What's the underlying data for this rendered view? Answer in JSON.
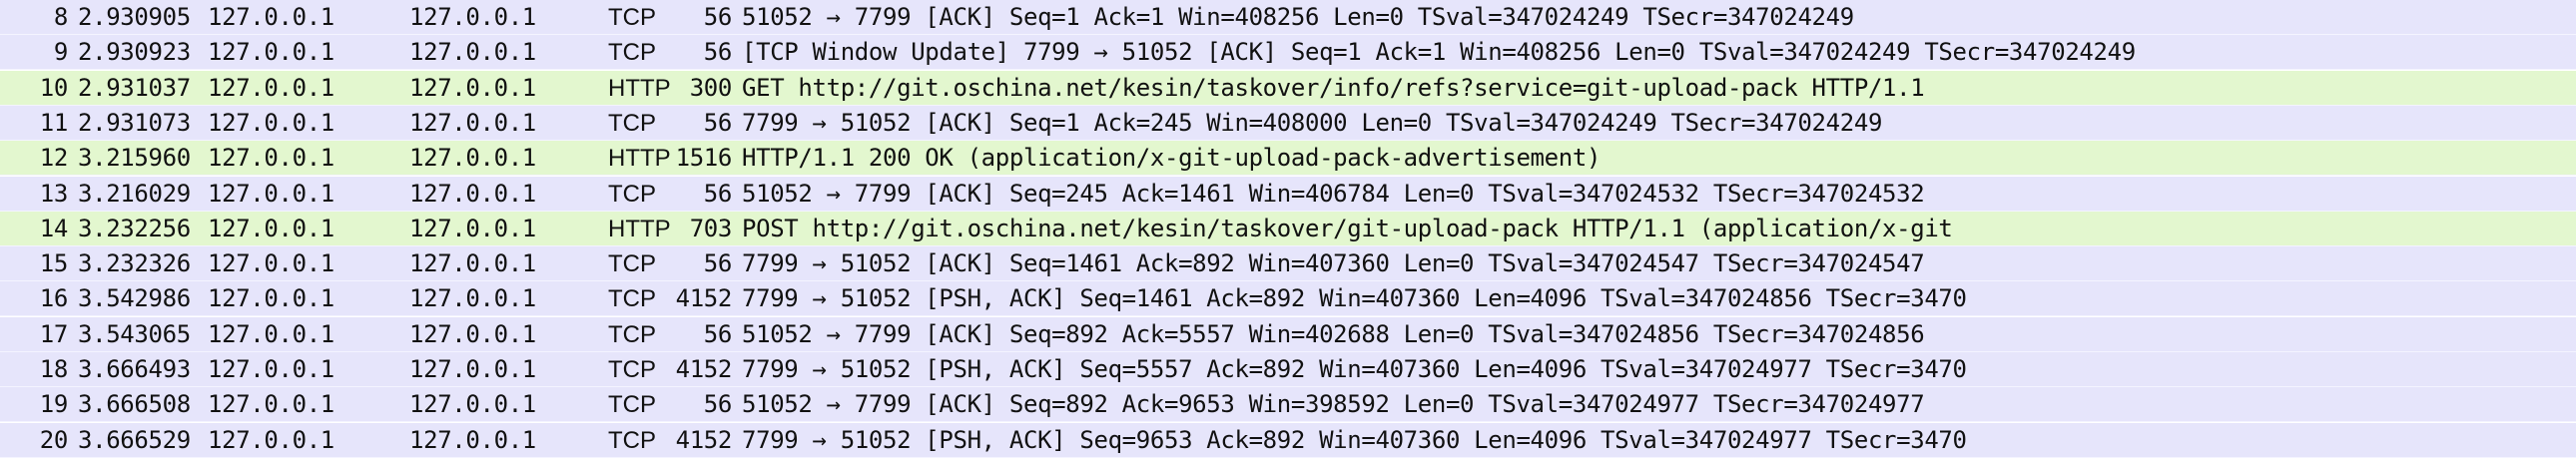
{
  "packet_list": {
    "rows": [
      {
        "no": "8",
        "time": "2.930905",
        "source": "127.0.0.1",
        "destination": "127.0.0.1",
        "protocol": "TCP",
        "length": "56",
        "info": "51052 → 7799 [ACK] Seq=1 Ack=1 Win=408256 Len=0 TSval=347024249 TSecr=347024249"
      },
      {
        "no": "9",
        "time": "2.930923",
        "source": "127.0.0.1",
        "destination": "127.0.0.1",
        "protocol": "TCP",
        "length": "56",
        "info": "[TCP Window Update] 7799 → 51052 [ACK] Seq=1 Ack=1 Win=408256 Len=0 TSval=347024249 TSecr=347024249"
      },
      {
        "no": "10",
        "time": "2.931037",
        "source": "127.0.0.1",
        "destination": "127.0.0.1",
        "protocol": "HTTP",
        "length": "300",
        "info": "GET http://git.oschina.net/kesin/taskover/info/refs?service=git-upload-pack HTTP/1.1"
      },
      {
        "no": "11",
        "time": "2.931073",
        "source": "127.0.0.1",
        "destination": "127.0.0.1",
        "protocol": "TCP",
        "length": "56",
        "info": "7799 → 51052 [ACK] Seq=1 Ack=245 Win=408000 Len=0 TSval=347024249 TSecr=347024249"
      },
      {
        "no": "12",
        "time": "3.215960",
        "source": "127.0.0.1",
        "destination": "127.0.0.1",
        "protocol": "HTTP",
        "length": "1516",
        "info": "HTTP/1.1 200 OK  (application/x-git-upload-pack-advertisement)"
      },
      {
        "no": "13",
        "time": "3.216029",
        "source": "127.0.0.1",
        "destination": "127.0.0.1",
        "protocol": "TCP",
        "length": "56",
        "info": "51052 → 7799 [ACK] Seq=245 Ack=1461 Win=406784 Len=0 TSval=347024532 TSecr=347024532"
      },
      {
        "no": "14",
        "time": "3.232256",
        "source": "127.0.0.1",
        "destination": "127.0.0.1",
        "protocol": "HTTP",
        "length": "703",
        "info": "POST http://git.oschina.net/kesin/taskover/git-upload-pack HTTP/1.1  (application/x-git"
      },
      {
        "no": "15",
        "time": "3.232326",
        "source": "127.0.0.1",
        "destination": "127.0.0.1",
        "protocol": "TCP",
        "length": "56",
        "info": "7799 → 51052 [ACK] Seq=1461 Ack=892 Win=407360 Len=0 TSval=347024547 TSecr=347024547"
      },
      {
        "no": "16",
        "time": "3.542986",
        "source": "127.0.0.1",
        "destination": "127.0.0.1",
        "protocol": "TCP",
        "length": "4152",
        "info": "7799 → 51052 [PSH, ACK] Seq=1461 Ack=892 Win=407360 Len=4096 TSval=347024856 TSecr=3470"
      },
      {
        "no": "17",
        "time": "3.543065",
        "source": "127.0.0.1",
        "destination": "127.0.0.1",
        "protocol": "TCP",
        "length": "56",
        "info": "51052 → 7799 [ACK] Seq=892 Ack=5557 Win=402688 Len=0 TSval=347024856 TSecr=347024856"
      },
      {
        "no": "18",
        "time": "3.666493",
        "source": "127.0.0.1",
        "destination": "127.0.0.1",
        "protocol": "TCP",
        "length": "4152",
        "info": "7799 → 51052 [PSH, ACK] Seq=5557 Ack=892 Win=407360 Len=4096 TSval=347024977 TSecr=3470"
      },
      {
        "no": "19",
        "time": "3.666508",
        "source": "127.0.0.1",
        "destination": "127.0.0.1",
        "protocol": "TCP",
        "length": "56",
        "info": "51052 → 7799 [ACK] Seq=892 Ack=9653 Win=398592 Len=0 TSval=347024977 TSecr=347024977"
      },
      {
        "no": "20",
        "time": "3.666529",
        "source": "127.0.0.1",
        "destination": "127.0.0.1",
        "protocol": "TCP",
        "length": "4152",
        "info": "7799 → 51052 [PSH, ACK] Seq=9653 Ack=892 Win=407360 Len=4096 TSval=347024977 TSecr=3470"
      }
    ]
  },
  "colors": {
    "tcp_row_bg": "#e6e5fb",
    "http_row_bg": "#e3f7cf",
    "text": "#111111"
  }
}
